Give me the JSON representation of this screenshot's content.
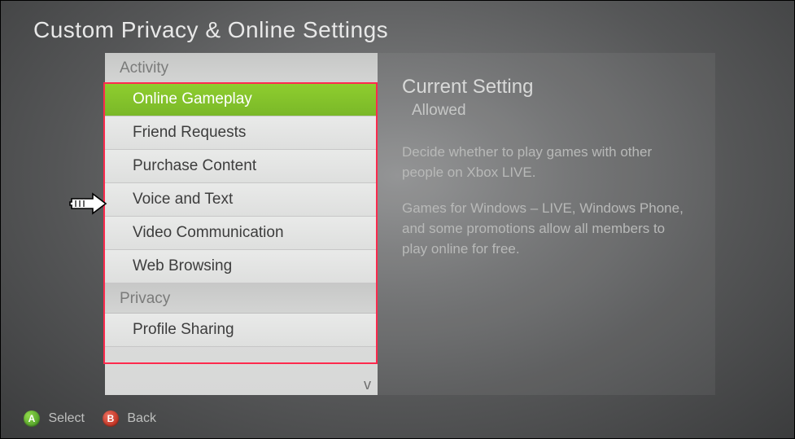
{
  "title": "Custom Privacy & Online Settings",
  "sections": [
    {
      "header": "Activity",
      "items": [
        {
          "label": "Online Gameplay",
          "selected": true
        },
        {
          "label": "Friend Requests"
        },
        {
          "label": "Purchase Content"
        },
        {
          "label": "Voice and Text"
        },
        {
          "label": "Video Communication"
        },
        {
          "label": "Web Browsing"
        }
      ]
    },
    {
      "header": "Privacy",
      "items": [
        {
          "label": "Profile Sharing"
        }
      ]
    }
  ],
  "current_setting": {
    "title": "Current Setting",
    "value": "Allowed",
    "desc1": "Decide whether to play games with other people on Xbox LIVE.",
    "desc2": "Games for Windows – LIVE, Windows Phone, and some promotions allow all members to play online for free."
  },
  "footer": {
    "a_glyph": "A",
    "a_label": "Select",
    "b_glyph": "B",
    "b_label": "Back"
  },
  "scroll_glyph": "v"
}
